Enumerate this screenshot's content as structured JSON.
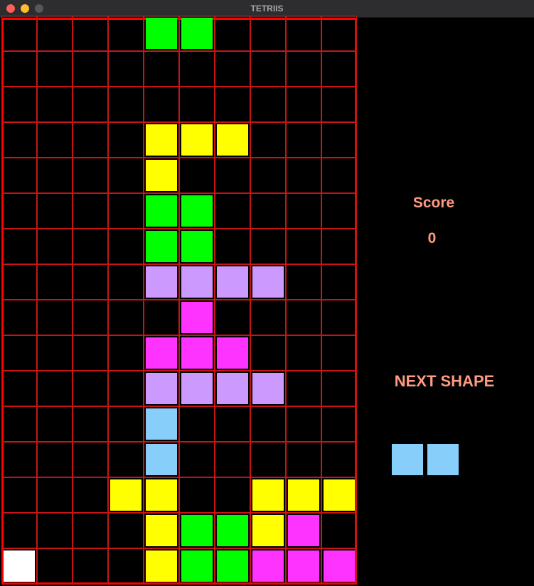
{
  "window": {
    "title": "TETRIIS"
  },
  "board": {
    "columns": 10,
    "rows": 16,
    "grid_color": "#c81414",
    "border_color": "#ff0000",
    "blocks": [
      {
        "col": 4,
        "row": 0,
        "color": "#00ff00"
      },
      {
        "col": 5,
        "row": 0,
        "color": "#00ff00"
      },
      {
        "col": 4,
        "row": 3,
        "color": "#ffff00"
      },
      {
        "col": 5,
        "row": 3,
        "color": "#ffff00"
      },
      {
        "col": 6,
        "row": 3,
        "color": "#ffff00"
      },
      {
        "col": 4,
        "row": 4,
        "color": "#ffff00"
      },
      {
        "col": 4,
        "row": 5,
        "color": "#00ff00"
      },
      {
        "col": 5,
        "row": 5,
        "color": "#00ff00"
      },
      {
        "col": 4,
        "row": 6,
        "color": "#00ff00"
      },
      {
        "col": 5,
        "row": 6,
        "color": "#00ff00"
      },
      {
        "col": 4,
        "row": 7,
        "color": "#cc99ff"
      },
      {
        "col": 5,
        "row": 7,
        "color": "#cc99ff"
      },
      {
        "col": 6,
        "row": 7,
        "color": "#cc99ff"
      },
      {
        "col": 7,
        "row": 7,
        "color": "#cc99ff"
      },
      {
        "col": 5,
        "row": 8,
        "color": "#ff33ff"
      },
      {
        "col": 4,
        "row": 9,
        "color": "#ff33ff"
      },
      {
        "col": 5,
        "row": 9,
        "color": "#ff33ff"
      },
      {
        "col": 6,
        "row": 9,
        "color": "#ff33ff"
      },
      {
        "col": 4,
        "row": 10,
        "color": "#cc99ff"
      },
      {
        "col": 5,
        "row": 10,
        "color": "#cc99ff"
      },
      {
        "col": 6,
        "row": 10,
        "color": "#cc99ff"
      },
      {
        "col": 7,
        "row": 10,
        "color": "#cc99ff"
      },
      {
        "col": 4,
        "row": 11,
        "color": "#87cefa"
      },
      {
        "col": 4,
        "row": 12,
        "color": "#87cefa"
      },
      {
        "col": 3,
        "row": 13,
        "color": "#ffff00"
      },
      {
        "col": 4,
        "row": 13,
        "color": "#ffff00"
      },
      {
        "col": 7,
        "row": 13,
        "color": "#ffff00"
      },
      {
        "col": 8,
        "row": 13,
        "color": "#ffff00"
      },
      {
        "col": 9,
        "row": 13,
        "color": "#ffff00"
      },
      {
        "col": 4,
        "row": 14,
        "color": "#ffff00"
      },
      {
        "col": 5,
        "row": 14,
        "color": "#00ff00"
      },
      {
        "col": 6,
        "row": 14,
        "color": "#00ff00"
      },
      {
        "col": 7,
        "row": 14,
        "color": "#ffff00"
      },
      {
        "col": 8,
        "row": 14,
        "color": "#ff33ff"
      },
      {
        "col": 0,
        "row": 15,
        "color": "#ffffff"
      },
      {
        "col": 4,
        "row": 15,
        "color": "#ffff00"
      },
      {
        "col": 5,
        "row": 15,
        "color": "#00ff00"
      },
      {
        "col": 6,
        "row": 15,
        "color": "#00ff00"
      },
      {
        "col": 7,
        "row": 15,
        "color": "#ff33ff"
      },
      {
        "col": 8,
        "row": 15,
        "color": "#ff33ff"
      },
      {
        "col": 9,
        "row": 15,
        "color": "#ff33ff"
      }
    ]
  },
  "sidebar": {
    "score_label": "Score",
    "score_value": "0",
    "next_label": "NEXT SHAPE",
    "text_color": "#ff9b82",
    "next_shape": {
      "color": "#87cefa",
      "cells": [
        {
          "col": 0,
          "row": 0
        },
        {
          "col": 1,
          "row": 0
        }
      ]
    }
  }
}
